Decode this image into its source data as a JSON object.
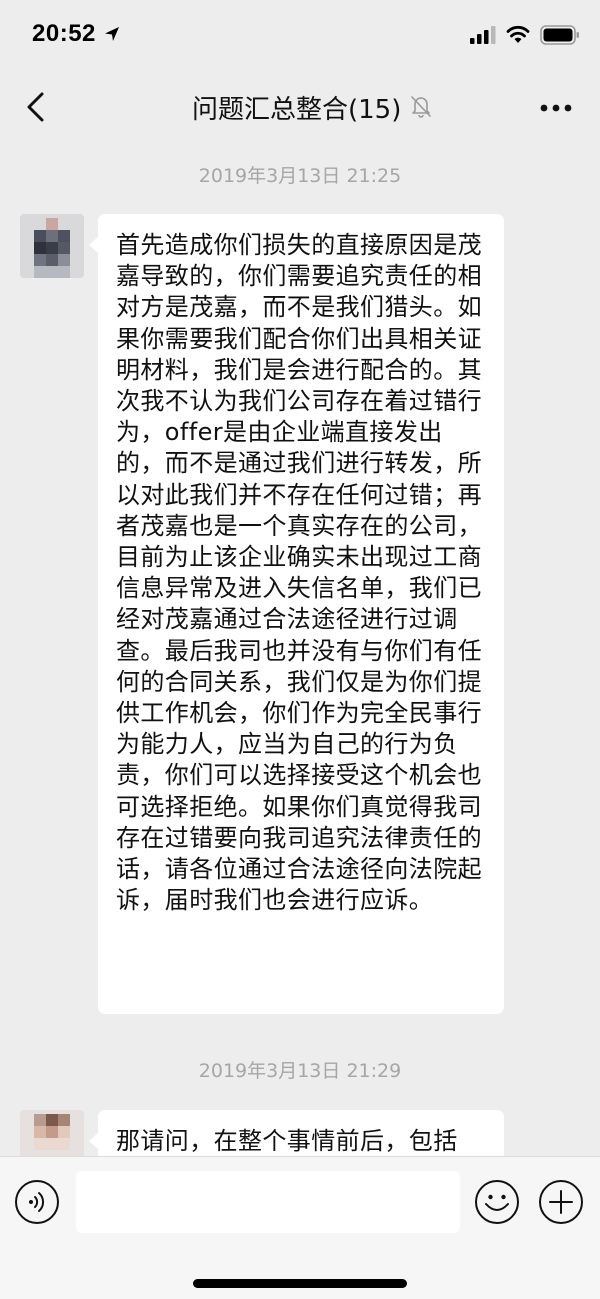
{
  "status_bar": {
    "time": "20:52",
    "icons": [
      "location-arrow-icon",
      "cellular-signal-icon",
      "wifi-icon",
      "battery-icon"
    ]
  },
  "nav": {
    "title": "问题汇总整合(15)",
    "back_icon": "chevron-left-icon",
    "mute_icon": "bell-muted-icon",
    "more_icon": "ellipsis-icon"
  },
  "chat": {
    "messages": [
      {
        "timestamp": "2019年3月13日 21:25",
        "text": "首先造成你们损失的直接原因是茂嘉导致的，你们需要追究责任的相对方是茂嘉，而不是我们猎头。如果你需要我们配合你们出具相关证明材料，我们是会进行配合的。其次我不认为我们公司存在着过错行为，offer是由企业端直接发出的，而不是通过我们进行转发，所以对此我们并不存在任何过错；再者茂嘉也是一个真实存在的公司，目前为止该企业确实未出现过工商信息异常及进入失信名单，我们已经对茂嘉通过合法途径进行过调查。最后我司也并没有与你们有任何的合同关系，我们仅是为你们提供工作机会，你们作为完全民事行为能力人，应当为自己的行为负责，你们可以选择接受这个机会也可选择拒绝。如果你们真觉得我司存在过错要向我司追究法律责任的话，请各位通过合法途径向法院起诉，届时我们也会进行应诉。"
      },
      {
        "timestamp": "2019年3月13日 21:29",
        "text": "那请问，在整个事情前后，包括"
      }
    ]
  },
  "input_bar": {
    "voice_icon": "voice-icon",
    "emoji_icon": "smiley-face-icon",
    "plus_icon": "plus-circle-icon",
    "input_value": ""
  },
  "colors": {
    "background": "#ededed",
    "bubble": "#ffffff",
    "timestamp_text": "#a6a6a6",
    "input_bar": "#f6f6f6"
  }
}
